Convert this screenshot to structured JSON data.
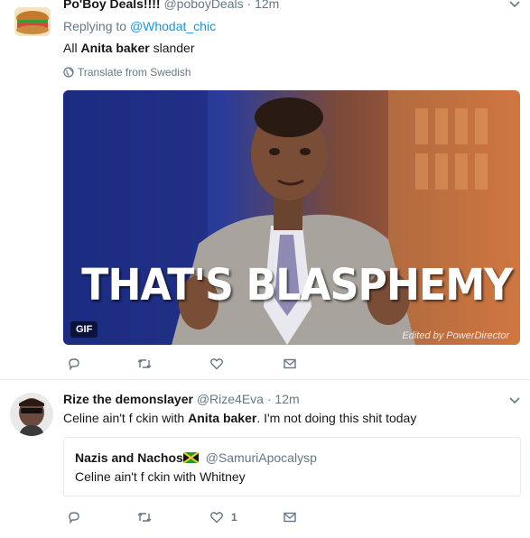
{
  "tweets": [
    {
      "display_name": "Po'Boy Deals!!!!",
      "handle": "@poboyDeals",
      "time": "· 12m",
      "replying_prefix": "Replying to",
      "replying_to": "@Whodat_chic",
      "text_pre": "All ",
      "text_bold": "Anita baker",
      "text_post": " slander",
      "translate_label": "Translate from Swedish",
      "media": {
        "caption": "THAT'S BLASPHEMY",
        "badge": "GIF",
        "watermark": "Edited by PowerDirector"
      },
      "actions": {
        "reply_count": "",
        "retweet_count": "",
        "like_count": ""
      }
    },
    {
      "display_name": "Rize the demonslayer",
      "handle": "@Rize4Eva",
      "time": "· 12m",
      "text_pre": "Celine ain't f  ckin with ",
      "text_bold": "Anita baker",
      "text_post": ". I'm not doing this shit today",
      "quote": {
        "display_name": "Nazis and Nachos",
        "handle": "@SamuriApocalysp",
        "text": "Celine ain't f  ckin with Whitney"
      },
      "actions": {
        "reply_count": "",
        "retweet_count": "",
        "like_count": "1"
      }
    }
  ],
  "colors": {
    "link": "#1b95e0",
    "muted": "#657786",
    "border": "#e6ecf0"
  }
}
